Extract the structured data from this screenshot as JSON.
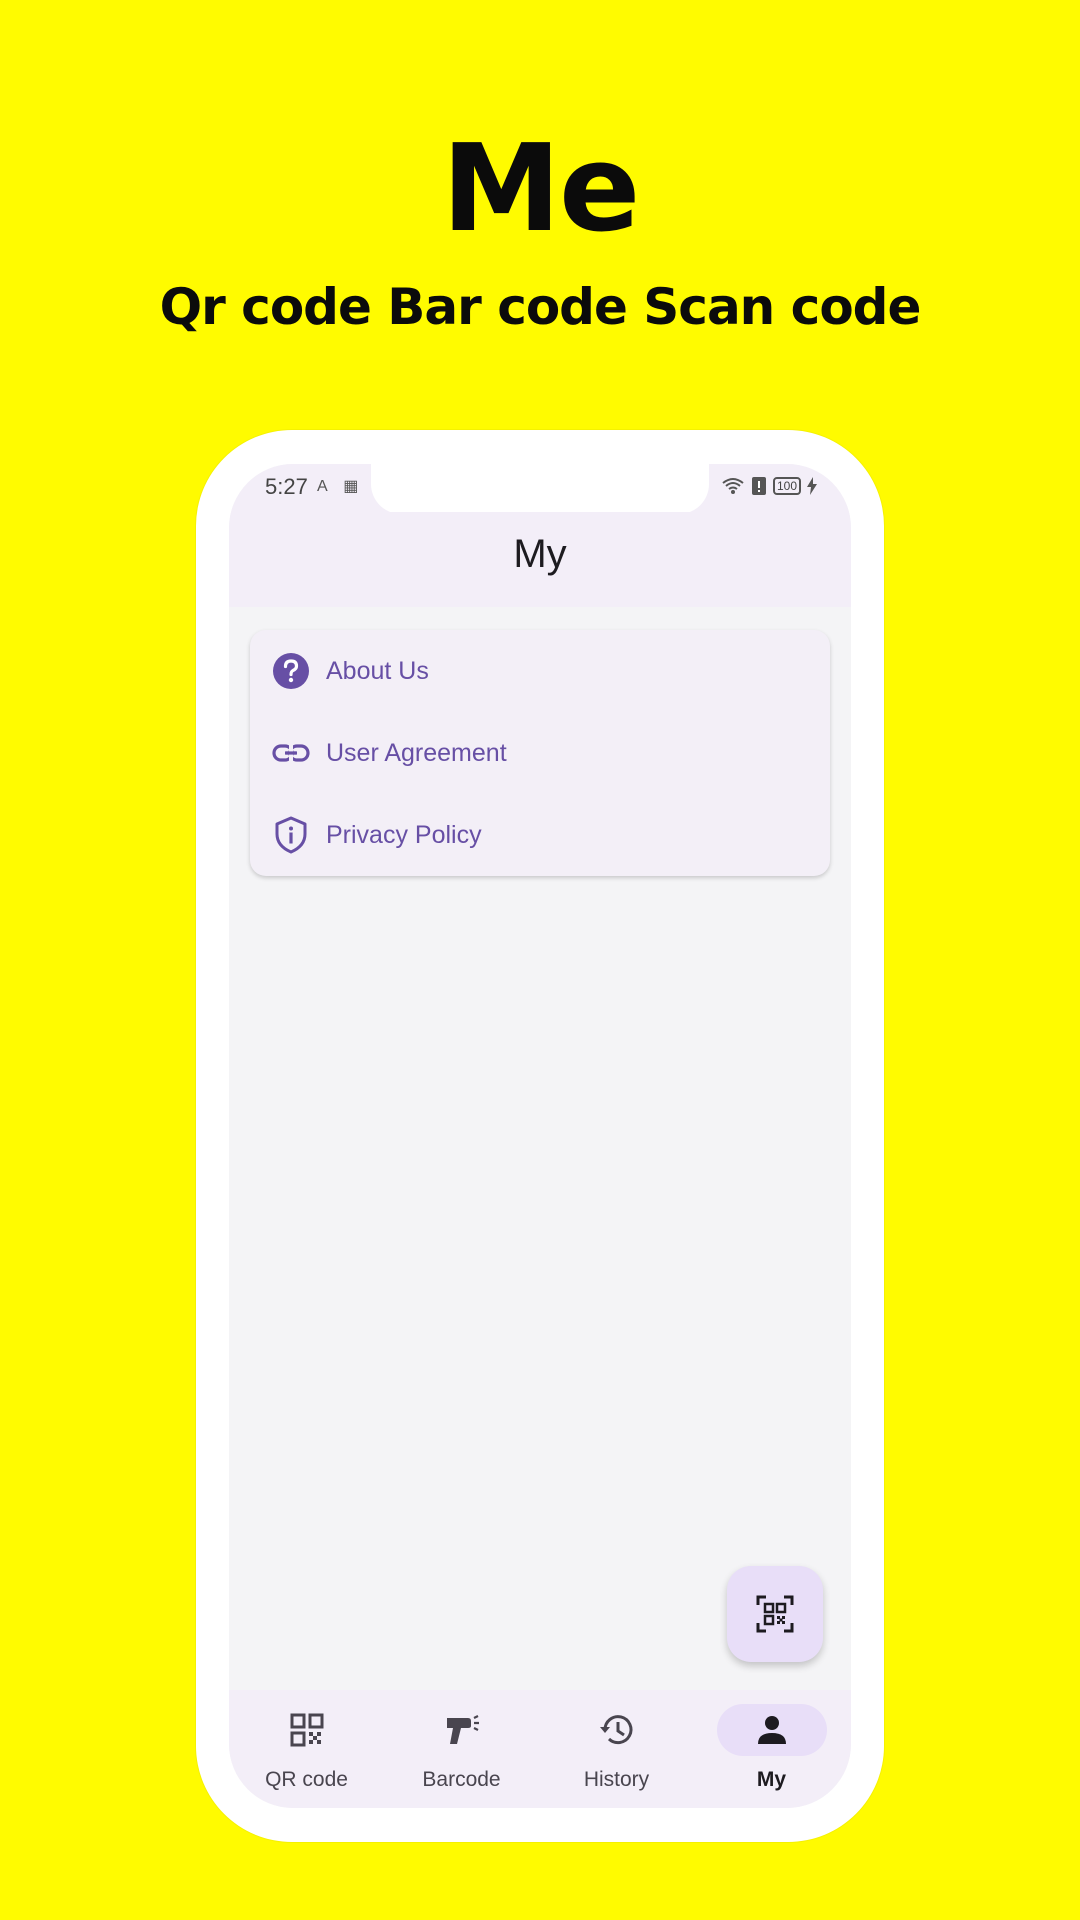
{
  "promo": {
    "title": "Me",
    "subtitle": "Qr code Bar code Scan code"
  },
  "status_bar": {
    "time": "5:27",
    "battery": "100"
  },
  "app_bar": {
    "title": "My"
  },
  "menu": {
    "items": [
      {
        "label": "About Us",
        "icon": "help-circle-icon"
      },
      {
        "label": "User Agreement",
        "icon": "link-icon"
      },
      {
        "label": "Privacy Policy",
        "icon": "shield-info-icon"
      }
    ]
  },
  "fab": {
    "icon": "qr-scan-icon"
  },
  "bottom_nav": {
    "items": [
      {
        "label": "QR code",
        "icon": "qr-code-icon"
      },
      {
        "label": "Barcode",
        "icon": "barcode-scanner-icon"
      },
      {
        "label": "History",
        "icon": "history-icon"
      },
      {
        "label": "My",
        "icon": "person-icon",
        "active": true
      }
    ]
  },
  "colors": {
    "background": "#FFFB00",
    "accent": "#674FA5",
    "nav_active": "#E8DEF8"
  }
}
